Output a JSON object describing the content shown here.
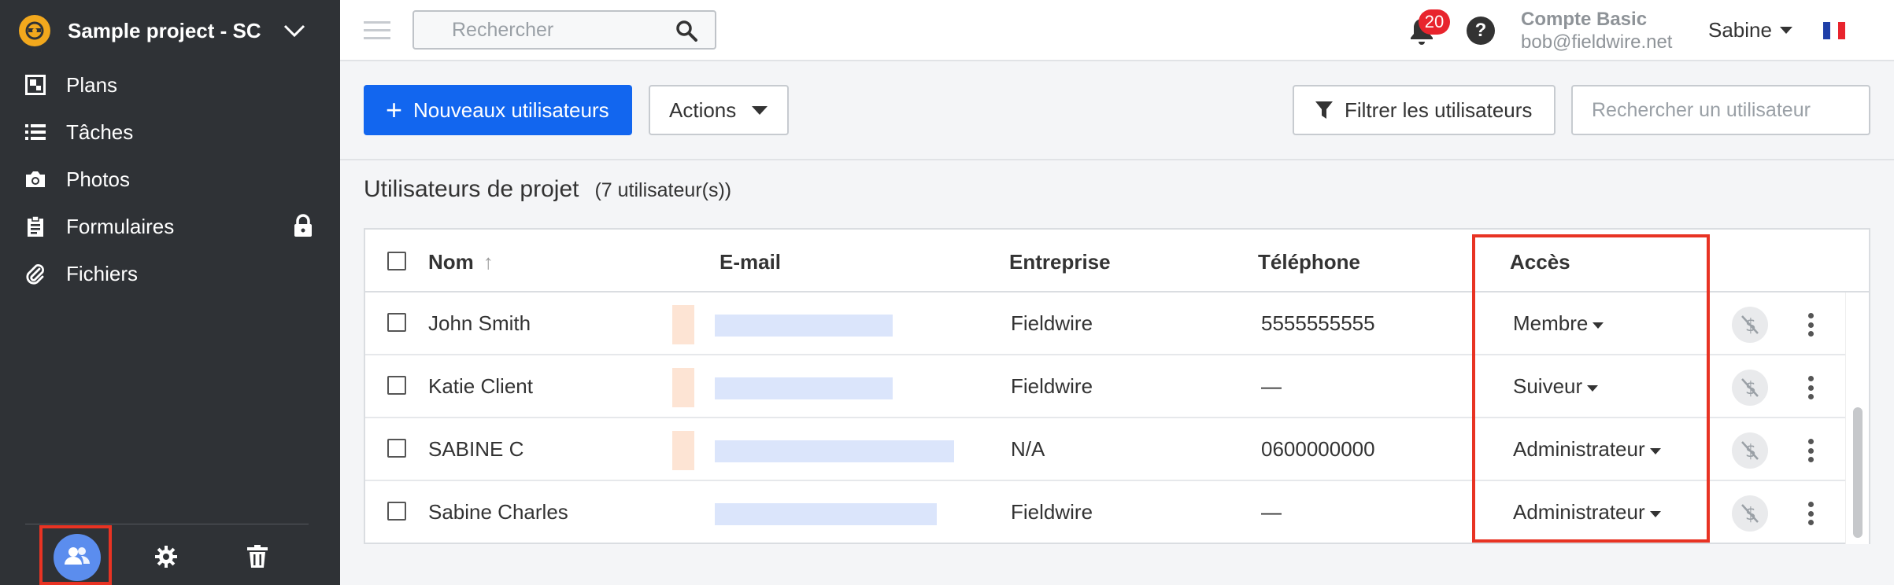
{
  "project": {
    "name": "Sample project - SC"
  },
  "sidebar": {
    "items": [
      {
        "label": "Plans",
        "icon": "plans-icon"
      },
      {
        "label": "Tâches",
        "icon": "tasks-list-icon"
      },
      {
        "label": "Photos",
        "icon": "camera-icon"
      },
      {
        "label": "Formulaires",
        "icon": "clipboard-icon",
        "locked": true
      },
      {
        "label": "Fichiers",
        "icon": "paperclip-icon"
      }
    ],
    "footer": [
      "users-icon",
      "gear-icon",
      "trash-icon"
    ]
  },
  "topbar": {
    "search_placeholder": "Rechercher",
    "notifications_count": "20",
    "help": "?",
    "account_plan": "Compte Basic",
    "account_email": "bob@fieldwire.net",
    "user_name": "Sabine",
    "language_flag": "fr"
  },
  "toolbar": {
    "new_users_label": "Nouveaux utilisateurs",
    "actions_label": "Actions",
    "filter_label": "Filtrer les utilisateurs",
    "user_search_placeholder": "Rechercher un utilisateur"
  },
  "section": {
    "title": "Utilisateurs de projet",
    "count": "(7 utilisateur(s))"
  },
  "table": {
    "columns": {
      "name": "Nom",
      "email": "E-mail",
      "company": "Entreprise",
      "phone": "Téléphone",
      "access": "Accès"
    },
    "rows": [
      {
        "name": "John Smith",
        "company": "Fieldwire",
        "phone": "5555555555",
        "access": "Membre"
      },
      {
        "name": "Katie Client",
        "company": "Fieldwire",
        "phone": "—",
        "access": "Suiveur"
      },
      {
        "name": "SABINE C",
        "company": "N/A",
        "phone": "0600000000",
        "access": "Administrateur"
      },
      {
        "name": "Sabine Charles",
        "company": "Fieldwire",
        "phone": "—",
        "access": "Administrateur"
      }
    ]
  },
  "colors": {
    "sidebar_bg": "#2f3236",
    "primary": "#1266ef",
    "highlight": "#e83323",
    "badge": "#e8242d"
  }
}
